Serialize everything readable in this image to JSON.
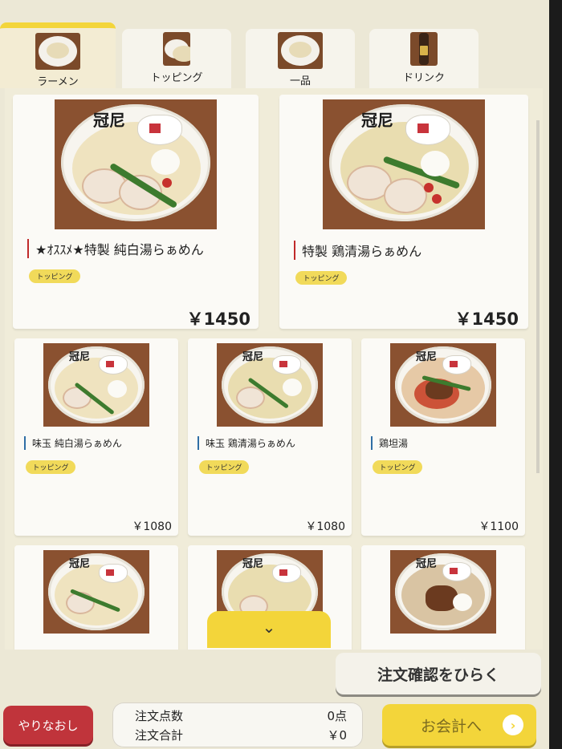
{
  "tabs": [
    {
      "label": "ラーメン",
      "icon": "ramen-photo",
      "active": true
    },
    {
      "label": "トッピング",
      "icon": "topping-photo",
      "active": false
    },
    {
      "label": "一品",
      "icon": "side-dish-photo",
      "active": false
    },
    {
      "label": "ドリンク",
      "icon": "beer-bottle-photo",
      "active": false
    }
  ],
  "menu": {
    "items": [
      {
        "name": "★ｵｽｽﾒ★特製 純白湯らぁめん",
        "badge": "トッピング",
        "price": "￥1450"
      },
      {
        "name": "特製 鶏清湯らぁめん",
        "badge": "トッピング",
        "price": "￥1450"
      },
      {
        "name": "味玉 純白湯らぁめん",
        "badge": "トッピング",
        "price": "￥1080"
      },
      {
        "name": "味玉 鶏清湯らぁめん",
        "badge": "トッピング",
        "price": "￥1080"
      },
      {
        "name": "鶏坦湯",
        "badge": "トッピング",
        "price": "￥1100"
      }
    ],
    "bowl_brand": "冠尼"
  },
  "scroll_down_icon": "chevron-down-icon",
  "confirm_button": "注文確認をひらく",
  "footer": {
    "redo_button": "やりなおし",
    "count_label": "注文点数",
    "count_value": "0点",
    "total_label": "注文合計",
    "total_value": "￥0",
    "checkout_button": "お会計へ",
    "checkout_arrow": "›"
  },
  "colors": {
    "accent_yellow": "#f3d53a",
    "redo_red": "#c0343b",
    "name_red": "#c02a2a",
    "name_blue": "#2f6ea5"
  }
}
